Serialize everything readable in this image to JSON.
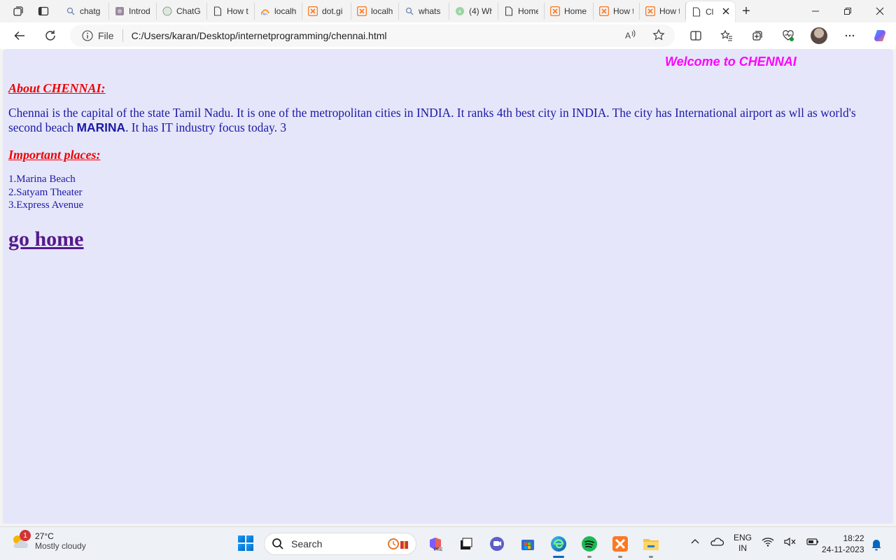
{
  "browser": {
    "tabs": [
      {
        "label": "chatg",
        "icon": "search-icon"
      },
      {
        "label": "Introd",
        "icon": "site-icon"
      },
      {
        "label": "ChatG",
        "icon": "chatgpt-icon"
      },
      {
        "label": "How t",
        "icon": "page-icon"
      },
      {
        "label": "localh",
        "icon": "phpmyadmin-icon"
      },
      {
        "label": "dot.gi",
        "icon": "xampp-icon"
      },
      {
        "label": "localh",
        "icon": "xampp-icon"
      },
      {
        "label": "whats",
        "icon": "search-icon"
      },
      {
        "label": "(4) Wh",
        "icon": "whatsapp-icon"
      },
      {
        "label": "Home",
        "icon": "page-icon"
      },
      {
        "label": "Home",
        "icon": "xampp-icon"
      },
      {
        "label": "How t",
        "icon": "xampp-icon"
      },
      {
        "label": "How t",
        "icon": "xampp-icon"
      },
      {
        "label": "Cl",
        "icon": "page-icon",
        "active": true
      }
    ],
    "address": {
      "scheme_label": "File",
      "url": "C:/Users/karan/Desktop/internetprogramming/chennai.html"
    }
  },
  "page": {
    "welcome": "Welcome to CHENNAI",
    "about_heading": "About CHENNAI:",
    "about_text_1": "Chennai is the capital of the state Tamil Nadu. It is one of the metropolitan cities in INDIA. It ranks 4th best city in INDIA. The city has International airport as wll as world's second beach ",
    "about_bold": "MARINA",
    "about_text_2": ". It has IT industry focus today. 3",
    "places_heading": "Important places:",
    "places": [
      "1.Marina Beach",
      "2.Satyam Theater",
      "3.Express Avenue"
    ],
    "home_link": "go home"
  },
  "taskbar": {
    "weather_temp": "27°C",
    "weather_desc": "Mostly cloudy",
    "weather_badge": "1",
    "search_placeholder": "Search",
    "lang_1": "ENG",
    "lang_2": "IN",
    "time": "18:22",
    "date": "24-11-2023"
  },
  "colors": {
    "page_bg": "#e6e6fa",
    "welcome": "#ff00ff",
    "heading": "#ee0000",
    "text": "#1a1aa6",
    "link": "#551a8b"
  }
}
